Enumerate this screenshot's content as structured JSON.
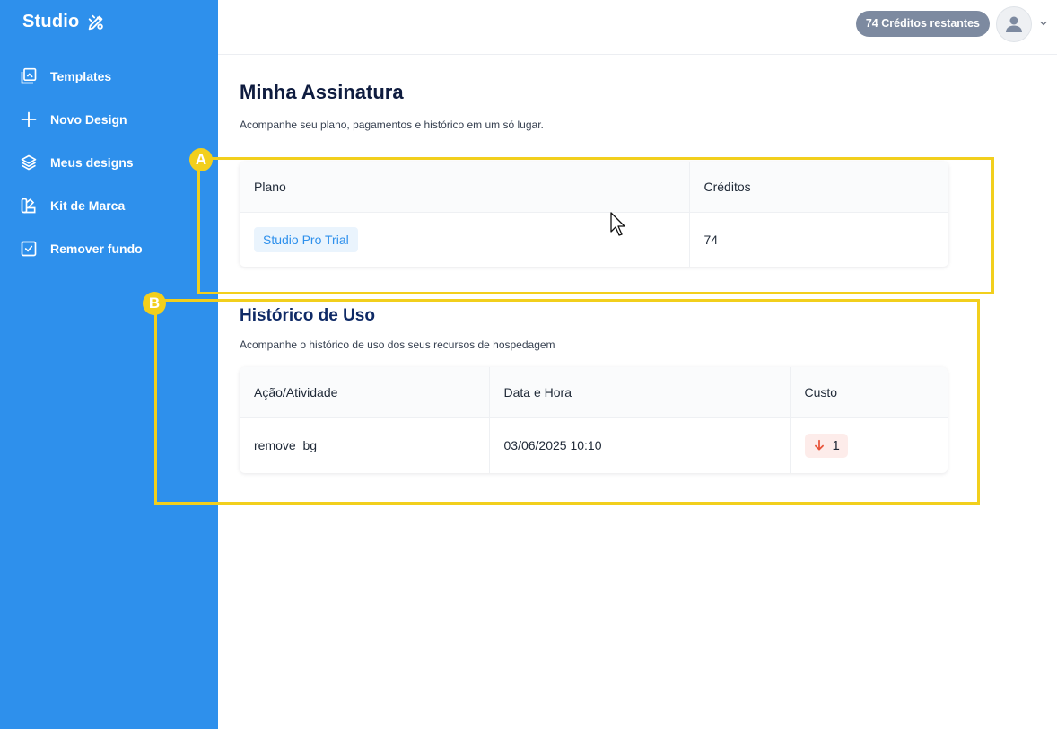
{
  "sidebar": {
    "logo_text": "Studio",
    "items": [
      {
        "label": "Templates",
        "icon": "templates-icon"
      },
      {
        "label": "Novo Design",
        "icon": "plus-icon"
      },
      {
        "label": "Meus designs",
        "icon": "layers-icon"
      },
      {
        "label": "Kit de Marca",
        "icon": "brand-kit-icon"
      },
      {
        "label": "Remover fundo",
        "icon": "checkbox-icon"
      }
    ]
  },
  "topbar": {
    "credits_label": "74 Créditos restantes"
  },
  "main": {
    "title": "Minha Assinatura",
    "subtitle": "Acompanhe seu plano, pagamentos e histórico em um só lugar.",
    "plan_table": {
      "headers": [
        "Plano",
        "Créditos"
      ],
      "row": {
        "plan": "Studio Pro Trial",
        "credits": "74"
      }
    },
    "usage": {
      "title": "Histórico de Uso",
      "subtitle": "Acompanhe o histórico de uso dos seus recursos de hospedagem",
      "headers": [
        "Ação/Atividade",
        "Data e Hora",
        "Custo"
      ],
      "rows": [
        {
          "action": "remove_bg",
          "datetime": "03/06/2025 10:10",
          "cost": "1"
        }
      ]
    }
  },
  "annotations": {
    "a": "A",
    "b": "B"
  },
  "colors": {
    "sidebar": "#2e90ec",
    "annotation": "#f2cf1c",
    "pill": "#7d8aa0"
  }
}
